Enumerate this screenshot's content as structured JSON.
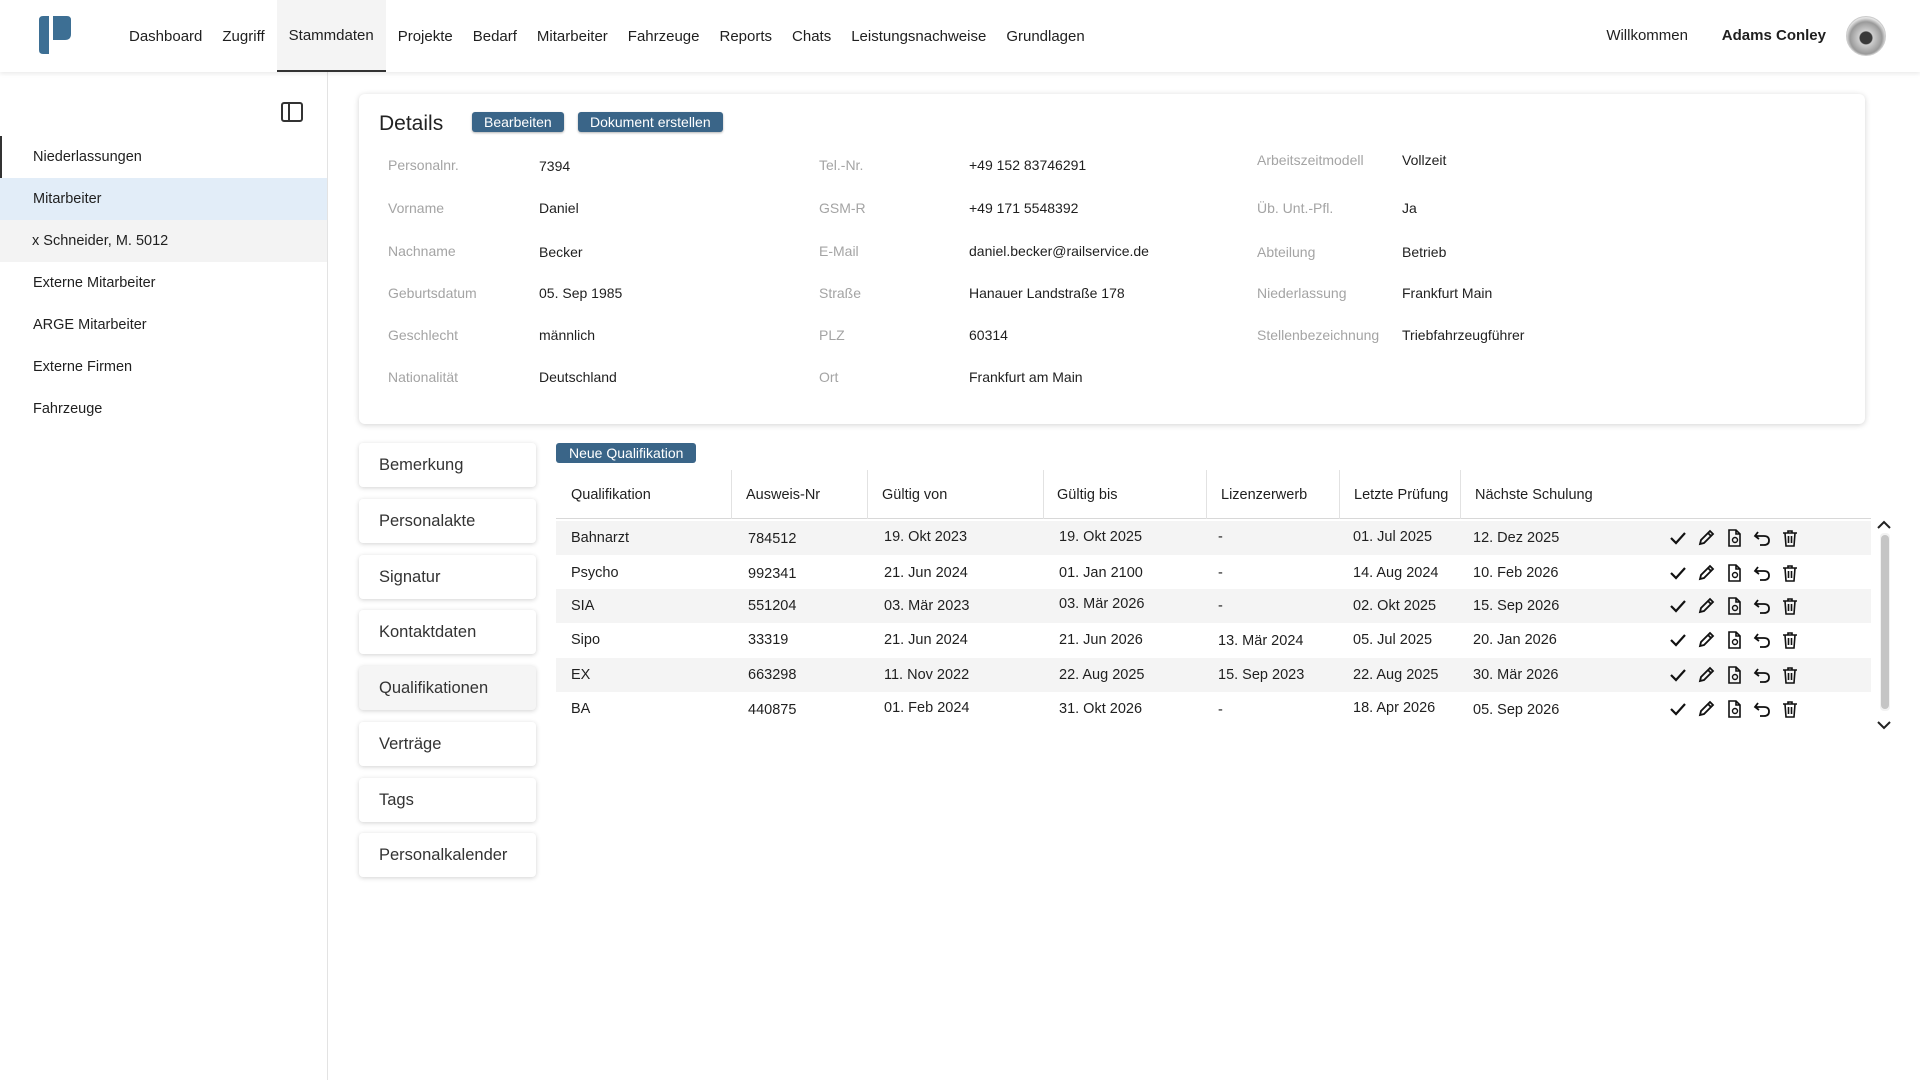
{
  "nav": [
    "Dashboard",
    "Zugriff",
    "Stammdaten",
    "Projekte",
    "Bedarf",
    "Mitarbeiter",
    "Fahrzeuge",
    "Reports",
    "Chats",
    "Leistungsnachweise",
    "Grundlagen"
  ],
  "header": {
    "welcome": "Willkommen",
    "user": "Adams Conley"
  },
  "sidebar": {
    "items": [
      "Niederlassungen",
      "Mitarbeiter",
      "x Schneider, M. 5012",
      "Externe Mitarbeiter",
      "ARGE Mitarbeiter",
      "Externe Firmen",
      "Fahrzeuge"
    ]
  },
  "details": {
    "title": "Details",
    "edit_label": "Bearbeiten",
    "doc_label": "Dokument erstellen",
    "col1": [
      {
        "label": "Personalnr.",
        "value": "7394"
      },
      {
        "label": "Vorname",
        "value": "Daniel"
      },
      {
        "label": "Nachname",
        "value": "Becker"
      },
      {
        "label": "Geburtsdatum",
        "value": "05. Sep 1985"
      },
      {
        "label": "Geschlecht",
        "value": "männlich"
      },
      {
        "label": "Nationalität",
        "value": "Deutschland"
      }
    ],
    "col2": [
      {
        "label": "Tel.-Nr.",
        "value": "+49 152 83746291"
      },
      {
        "label": "GSM-R",
        "value": "+49 171 5548392"
      },
      {
        "label": "E-Mail",
        "value": "daniel.becker@railservice.de"
      },
      {
        "label": "Straße",
        "value": "Hanauer Landstraße 178"
      },
      {
        "label": "PLZ",
        "value": "60314"
      },
      {
        "label": "Ort",
        "value": "Frankfurt am Main"
      }
    ],
    "col3": [
      {
        "label": "Arbeitszeitmodell",
        "value": "Vollzeit"
      },
      {
        "label": "Üb. Unt.-Pfl.",
        "value": "Ja"
      },
      {
        "label": "Abteilung",
        "value": "Betrieb"
      },
      {
        "label": "Niederlassung",
        "value": "Frankfurt Main"
      },
      {
        "label": "Stellenbezeichnung",
        "value": "Triebfahrzeugführer"
      }
    ]
  },
  "tabs": [
    "Bemerkung",
    "Personalakte",
    "Signatur",
    "Kontaktdaten",
    "Qualifikationen",
    "Verträge",
    "Tags",
    "Personalkalender"
  ],
  "qualifications": {
    "new_label": "Neue Qualifikation",
    "headers": [
      "Qualifikation",
      "Ausweis-Nr",
      "Gültig von",
      "Gültig bis",
      "Lizenzerwerb",
      "Letzte Prüfung",
      "Nächste Schulung"
    ],
    "rows": [
      [
        "Bahnarzt",
        "784512",
        "19. Okt 2023",
        "19. Okt 2025",
        "-",
        "01. Jul 2025",
        "12. Dez 2025"
      ],
      [
        "Psycho",
        "992341",
        "21. Jun 2024",
        "01. Jan 2100",
        "-",
        "14. Aug 2024",
        "10. Feb 2026"
      ],
      [
        "SIA",
        "551204",
        "03. Mär 2023",
        "03. Mär 2026",
        "-",
        "02. Okt 2025",
        "15. Sep 2026"
      ],
      [
        "Sipo",
        "33319",
        "21. Jun 2024",
        "21. Jun 2026",
        "13. Mär 2024",
        "05. Jul 2025",
        "20. Jan 2026"
      ],
      [
        "EX",
        "663298",
        "11. Nov 2022",
        "22. Aug 2025",
        "15. Sep 2023",
        "22. Aug 2025",
        "30. Mär 2026"
      ],
      [
        "BA",
        "440875",
        "01. Feb 2024",
        "31. Okt 2026",
        "-",
        "18. Apr 2026",
        "05. Sep 2026"
      ]
    ]
  },
  "colors": {
    "accent": "#3a6588",
    "active_sidebar": "#e2edf8",
    "logo": "#3d6f94"
  },
  "icons": [
    "check-icon",
    "pencil-icon",
    "document-icon",
    "undo-icon",
    "trash-icon"
  ]
}
